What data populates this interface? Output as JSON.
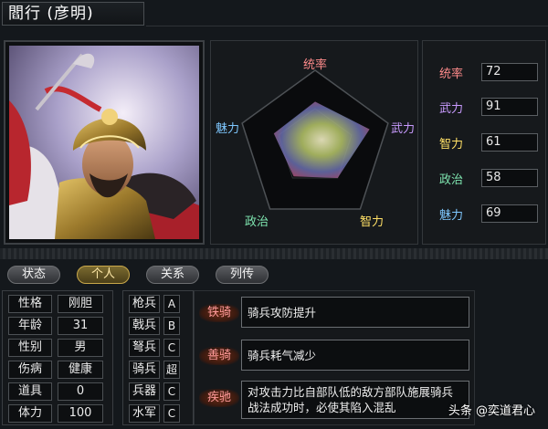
{
  "character": {
    "name": "閻行 (彦明)"
  },
  "attributes": [
    {
      "label": "统率",
      "value": "72",
      "color": "#ff8b8b"
    },
    {
      "label": "武力",
      "value": "91",
      "color": "#c99bff"
    },
    {
      "label": "智力",
      "value": "61",
      "color": "#ffe066"
    },
    {
      "label": "政治",
      "value": "58",
      "color": "#7fe6b0"
    },
    {
      "label": "魅力",
      "value": "69",
      "color": "#7fc8ff"
    }
  ],
  "radar": {
    "labels": {
      "top": "统率",
      "right": "武力",
      "bottom_right": "智力",
      "bottom_left": "政治",
      "left": "魅力"
    },
    "values": [
      72,
      91,
      61,
      58,
      69
    ],
    "max": 100
  },
  "tabs": [
    {
      "label": "状态",
      "active": false
    },
    {
      "label": "个人",
      "active": true
    },
    {
      "label": "关系",
      "active": false
    },
    {
      "label": "列传",
      "active": false
    }
  ],
  "personal": [
    {
      "label": "性格",
      "value": "刚胆"
    },
    {
      "label": "年龄",
      "value": "31"
    },
    {
      "label": "性别",
      "value": "男"
    },
    {
      "label": "伤病",
      "value": "健康"
    },
    {
      "label": "道具",
      "value": "0"
    },
    {
      "label": "体力",
      "value": "100"
    }
  ],
  "units": [
    {
      "label": "枪兵",
      "grade": "A"
    },
    {
      "label": "戟兵",
      "grade": "B"
    },
    {
      "label": "弩兵",
      "grade": "C"
    },
    {
      "label": "骑兵",
      "grade": "超"
    },
    {
      "label": "兵器",
      "grade": "C"
    },
    {
      "label": "水军",
      "grade": "C"
    }
  ],
  "skills": [
    {
      "name": "铁骑",
      "desc": "骑兵攻防提升"
    },
    {
      "name": "善骑",
      "desc": "骑兵耗气减少"
    },
    {
      "name": "疾驰",
      "desc": "对攻击力比自部队低的敌方部队施展骑兵战法成功时，必使其陷入混乱"
    }
  ],
  "watermark": "头条 @奕道君心"
}
